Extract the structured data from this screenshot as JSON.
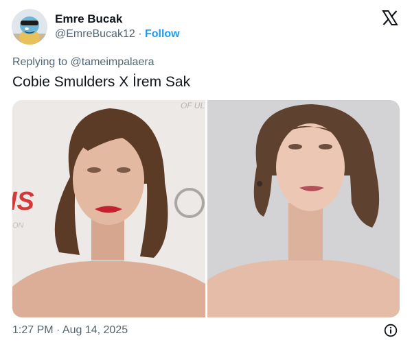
{
  "author": {
    "name": "Emre Bucak",
    "handle": "@EmreBucak12",
    "separator": "·",
    "follow_label": "Follow",
    "avatar_icon": "cartoon-turtle-avatar"
  },
  "platform_icon": "x-logo-icon",
  "reply": {
    "prefix": "Replying to",
    "mention": "@tameimpalaera"
  },
  "tweet_text": "Cobie Smulders X İrem Sak",
  "media": {
    "left_image_icon": "portrait-photo-left",
    "right_image_icon": "portrait-photo-right"
  },
  "timestamp": "1:27 PM · Aug 14, 2025",
  "info_icon": "info-icon",
  "colors": {
    "text_primary": "#0f1419",
    "text_secondary": "#536471",
    "link_blue": "#1d9bf0"
  }
}
